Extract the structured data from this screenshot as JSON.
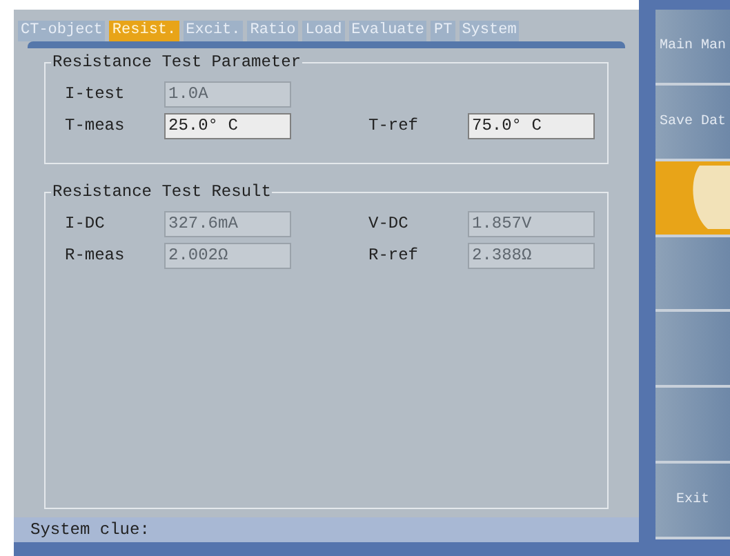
{
  "tabs": [
    {
      "label": "CT-object",
      "selected": false
    },
    {
      "label": "Resist.",
      "selected": true
    },
    {
      "label": "Excit.",
      "selected": false
    },
    {
      "label": "Ratio",
      "selected": false
    },
    {
      "label": "Load",
      "selected": false
    },
    {
      "label": "Evaluate",
      "selected": false
    },
    {
      "label": "PT",
      "selected": false
    },
    {
      "label": "System",
      "selected": false
    }
  ],
  "groups": [
    {
      "title": "Resistance Test Parameter",
      "rows": [
        [
          {
            "label": "I-test",
            "value": "1.0A",
            "disabled": true
          }
        ],
        [
          {
            "label": "T-meas",
            "value": "25.0° C",
            "disabled": false
          },
          {
            "label": "T-ref",
            "value": "75.0° C",
            "disabled": false
          }
        ]
      ]
    },
    {
      "title": "Resistance Test Result",
      "rows": [
        [
          {
            "label": "I-DC",
            "value": "327.6mA",
            "disabled": true
          },
          {
            "label": "V-DC",
            "value": "1.857V",
            "disabled": true
          }
        ],
        [
          {
            "label": "R-meas",
            "value": "2.002Ω",
            "disabled": true
          },
          {
            "label": "R-ref",
            "value": "2.388Ω",
            "disabled": true
          }
        ]
      ]
    }
  ],
  "status_bar": {
    "label": "System clue:"
  },
  "sidebar": {
    "items": [
      {
        "label": "Main Man",
        "selected": false
      },
      {
        "label": "Save Dat",
        "selected": false
      },
      {
        "selected": true
      },
      {
        "selected": false
      },
      {
        "selected": false
      },
      {
        "selected": false
      },
      {
        "label": "Exit",
        "selected": false
      }
    ]
  }
}
